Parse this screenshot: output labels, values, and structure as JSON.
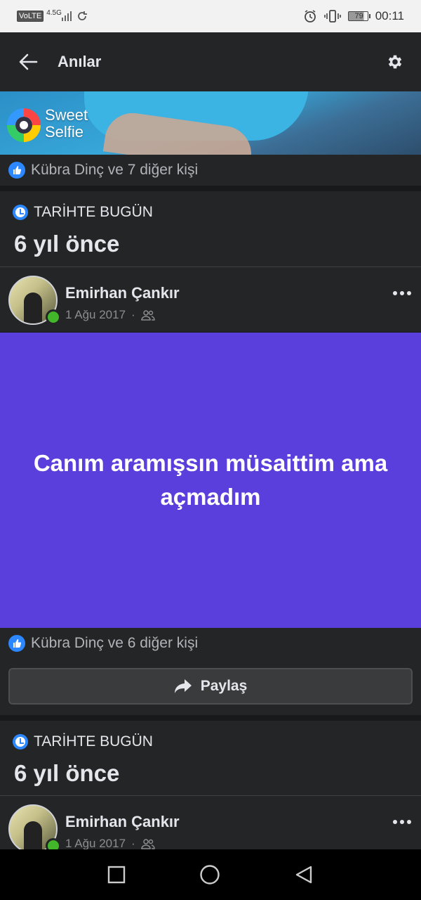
{
  "status_bar": {
    "volte": "VoLTE",
    "network": "4.5G",
    "battery": "79",
    "time": "00:11"
  },
  "app_bar": {
    "title": "Anılar"
  },
  "banner": {
    "brand_line1": "Sweet",
    "brand_line2": "Selfie"
  },
  "memories": [
    {
      "likes_text": "Kübra Dinç ve 7 diğer kişi"
    },
    {
      "section_label": "TARİHTE BUGÜN",
      "years_ago": "6 yıl önce",
      "author": "Emirhan Çankır",
      "date": "1 Ağu 2017",
      "post_text": "Canım aramışsın müsaittim ama açmadım",
      "post_bg": "#5b3fdc",
      "likes_text": "Kübra Dinç ve 6 diğer kişi",
      "share_label": "Paylaş"
    },
    {
      "section_label": "TARİHTE BUGÜN",
      "years_ago": "6 yıl önce",
      "author": "Emirhan Çankır",
      "date": "1 Ağu 2017"
    }
  ],
  "icons": {
    "back": "back-arrow-icon",
    "settings": "gear-icon",
    "like": "thumbs-up-icon",
    "clock": "clock-icon",
    "audience": "friends-icon",
    "more": "more-horizontal-icon",
    "share": "share-arrow-icon",
    "nav_recent": "square-icon",
    "nav_home": "circle-icon",
    "nav_back": "triangle-back-icon"
  }
}
